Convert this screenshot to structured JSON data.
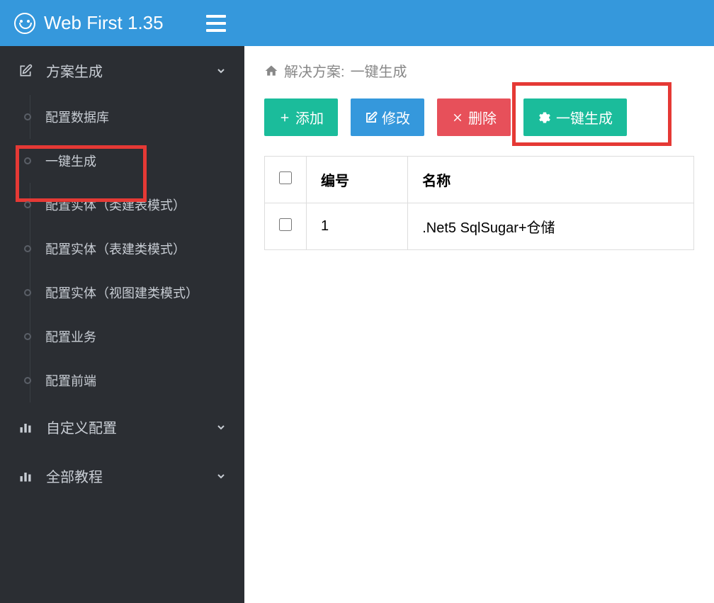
{
  "header": {
    "title": "Web First 1.35"
  },
  "sidebar": {
    "sections": [
      {
        "label": "方案生成",
        "icon": "edit",
        "expanded": true,
        "items": [
          {
            "label": "配置数据库"
          },
          {
            "label": "一键生成",
            "active": true
          },
          {
            "label": "配置实体（类建表模式）"
          },
          {
            "label": "配置实体（表建类模式）"
          },
          {
            "label": "配置实体（视图建类模式）"
          },
          {
            "label": "配置业务"
          },
          {
            "label": "配置前端"
          }
        ]
      },
      {
        "label": "自定义配置",
        "icon": "bar-chart",
        "expanded": false
      },
      {
        "label": "全部教程",
        "icon": "bar-chart",
        "expanded": false
      }
    ]
  },
  "breadcrumb": {
    "root": "解决方案:",
    "current": "一键生成"
  },
  "toolbar": {
    "add": "添加",
    "edit": "修改",
    "delete": "删除",
    "generate": "一键生成"
  },
  "table": {
    "headers": {
      "id": "编号",
      "name": "名称"
    },
    "rows": [
      {
        "id": "1",
        "name": ".Net5 SqlSugar+仓储"
      }
    ]
  }
}
